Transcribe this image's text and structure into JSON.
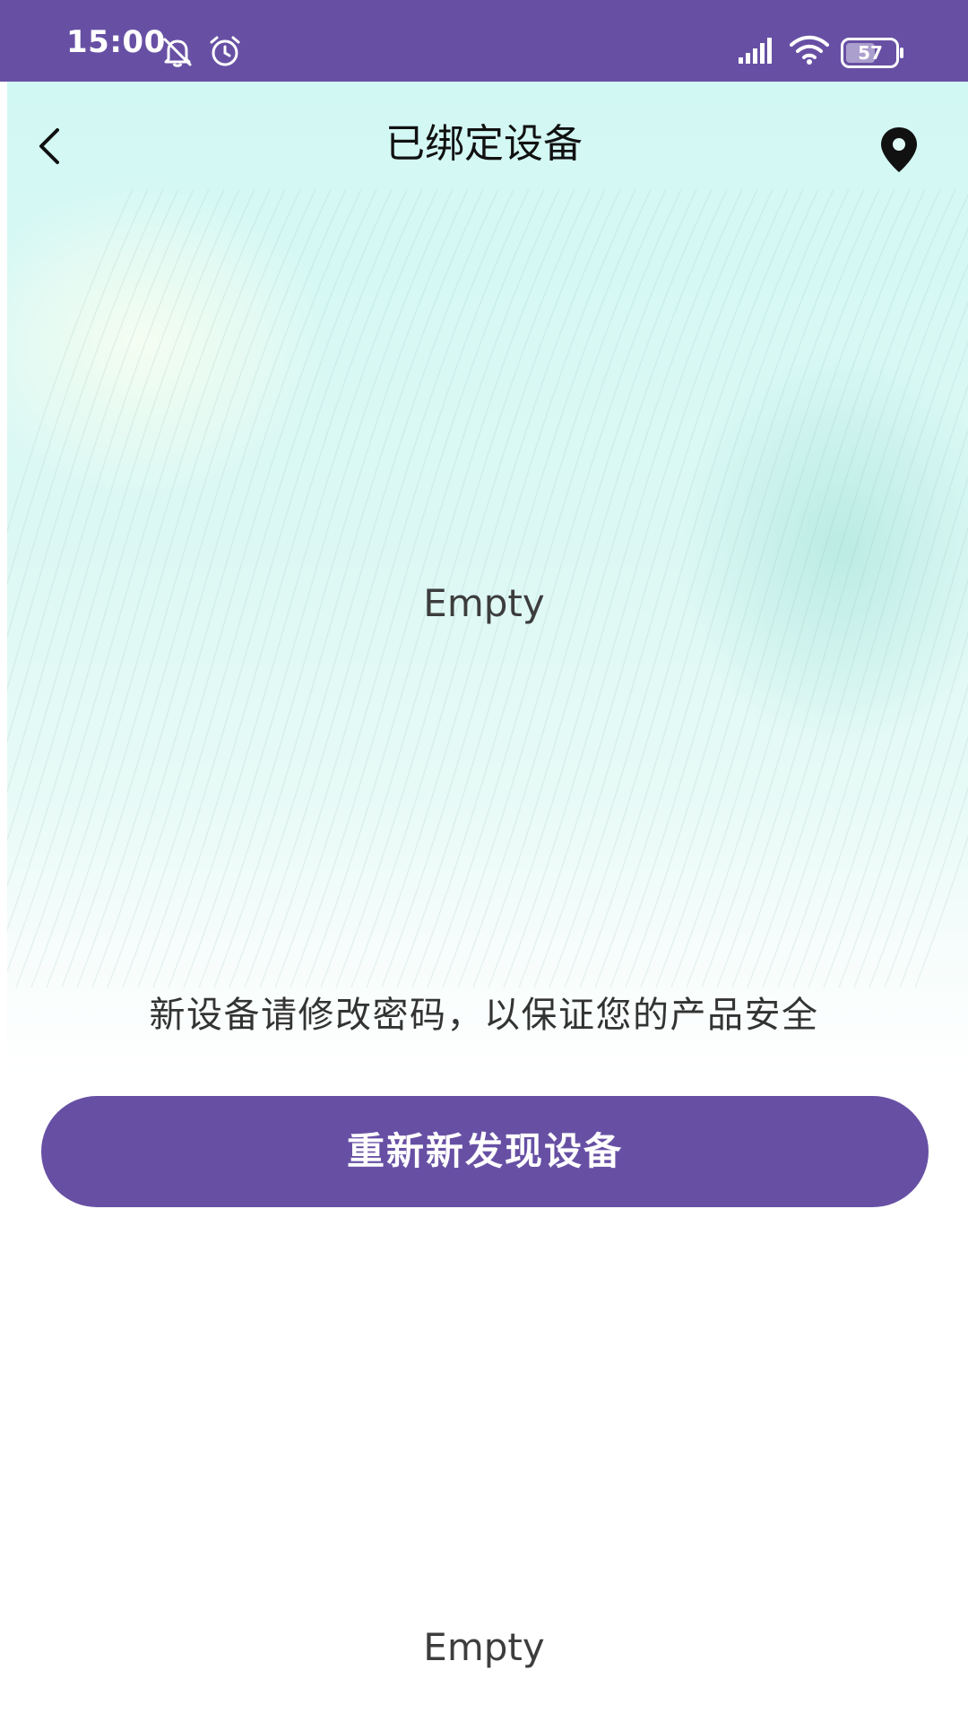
{
  "status_bar": {
    "time": "15:00",
    "battery": "57",
    "icons": [
      "bell-off-icon",
      "alarm-icon",
      "signal-icon",
      "wifi-icon",
      "battery-icon"
    ]
  },
  "header": {
    "title": "已绑定设备",
    "back_icon": "chevron-left-icon",
    "location_icon": "location-pin-icon"
  },
  "device_list": {
    "empty_text": "Empty"
  },
  "security_note": "新设备请修改密码，以保证您的产品安全",
  "rediscover_button": {
    "label": "重新新发现设备"
  },
  "discovered_list": {
    "empty_text": "Empty"
  },
  "colors": {
    "primary": "#6750a4",
    "background_tint": "#d2f8f4",
    "text": "#333333"
  }
}
